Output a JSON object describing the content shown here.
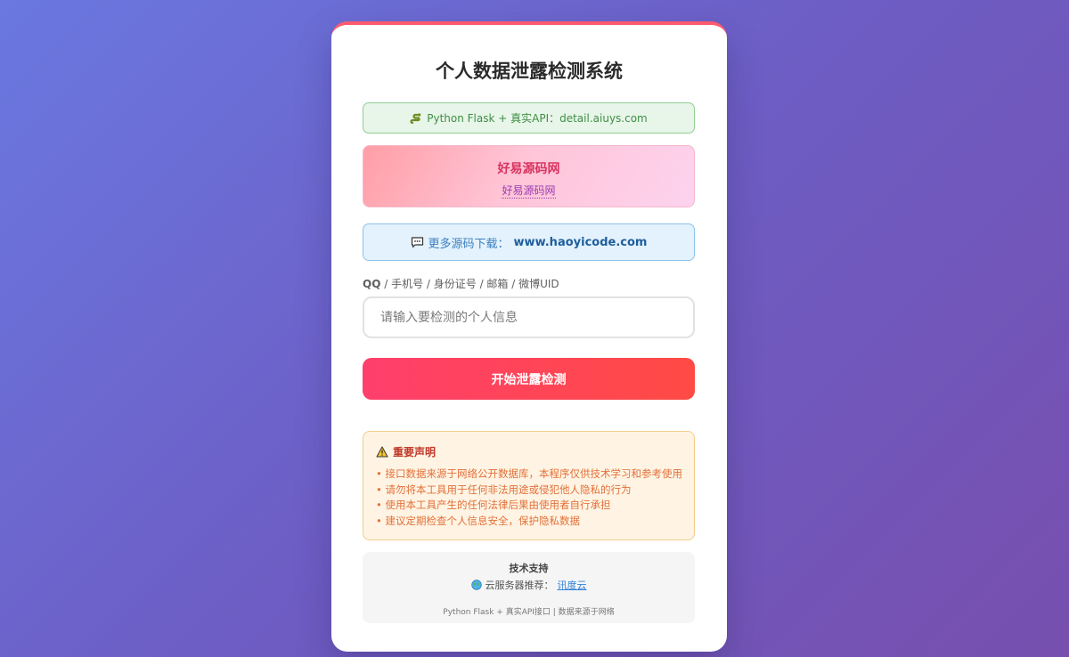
{
  "page": {
    "title": "个人数据泄露检测系统"
  },
  "api_banner": {
    "icon": "snake-icon",
    "text": "Python Flask + 真实API：detail.aiuys.com"
  },
  "promo": {
    "title": "好易源码网",
    "link_text": "好易源码网"
  },
  "download": {
    "icon": "chat-bubble-icon",
    "prefix": "更多源码下载：",
    "url": "www.haoyicode.com"
  },
  "form": {
    "label_qq": "QQ",
    "label_rest": " / 手机号 / 身份证号 / 邮箱 / 微博UID",
    "placeholder": "请输入要检测的个人信息",
    "value": "",
    "submit_label": "开始泄露检测"
  },
  "notice": {
    "icon": "warning-icon",
    "title": "重要声明",
    "items": [
      "接口数据来源于网络公开数据库，本程序仅供技术学习和参考使用",
      "请勿将本工具用于任何非法用途或侵犯他人隐私的行为",
      "使用本工具产生的任何法律后果由使用者自行承担",
      "建议定期检查个人信息安全，保护隐私数据"
    ]
  },
  "support": {
    "title": "技术支持",
    "icon": "globe-icon",
    "cloud_prefix": "云服务器推荐：",
    "cloud_link": "讯度云",
    "footer": "Python Flask + 真实API接口 | 数据来源于网络"
  },
  "colors": {
    "accent": "#ff4a5c",
    "background_start": "#6a78e0",
    "background_end": "#774fae"
  }
}
